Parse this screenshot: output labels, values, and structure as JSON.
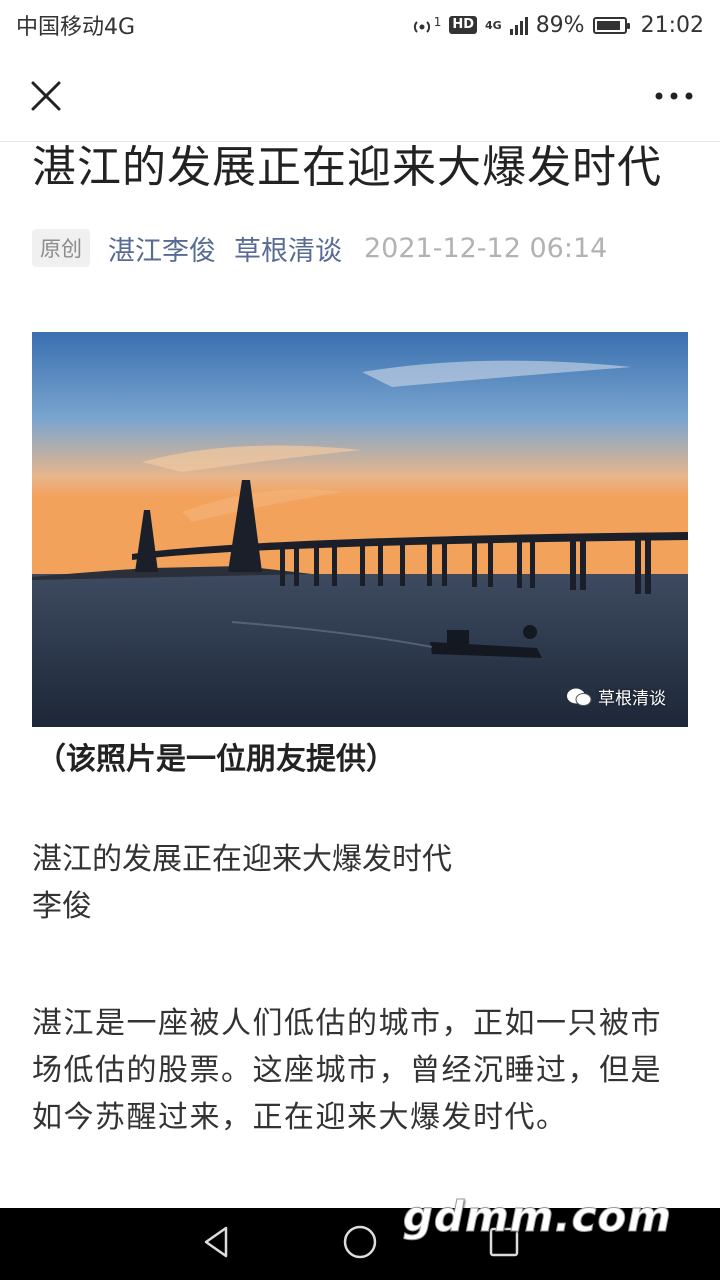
{
  "status_bar": {
    "carrier": "中国移动4G",
    "hotspot_sup": "1",
    "hd": "HD",
    "network": "4G",
    "battery": "89%",
    "battery_level": 0.89,
    "time": "21:02"
  },
  "nav": {
    "close_icon": "close-icon",
    "more_icon": "more-icon"
  },
  "article": {
    "title": "湛江的发展正在迎来大爆发时代",
    "badge": "原创",
    "author": "湛江李俊",
    "publisher": "草根清谈",
    "date": "2021-12-12 06:14",
    "photo_watermark": "草根清谈",
    "photo_caption": "（该照片是一位朋友提供）",
    "body_title": "湛江的发展正在迎来大爆发时代",
    "body_author": "李俊",
    "paragraph": "湛江是一座被人们低估的城市，正如一只被市场低估的股票。这座城市，曾经沉睡过，但是如今苏醒过来，正在迎来大爆发时代。"
  },
  "system_nav": {
    "back": "back-icon",
    "home": "home-icon",
    "recents": "recents-icon"
  },
  "site_watermark": "gdmm.com"
}
